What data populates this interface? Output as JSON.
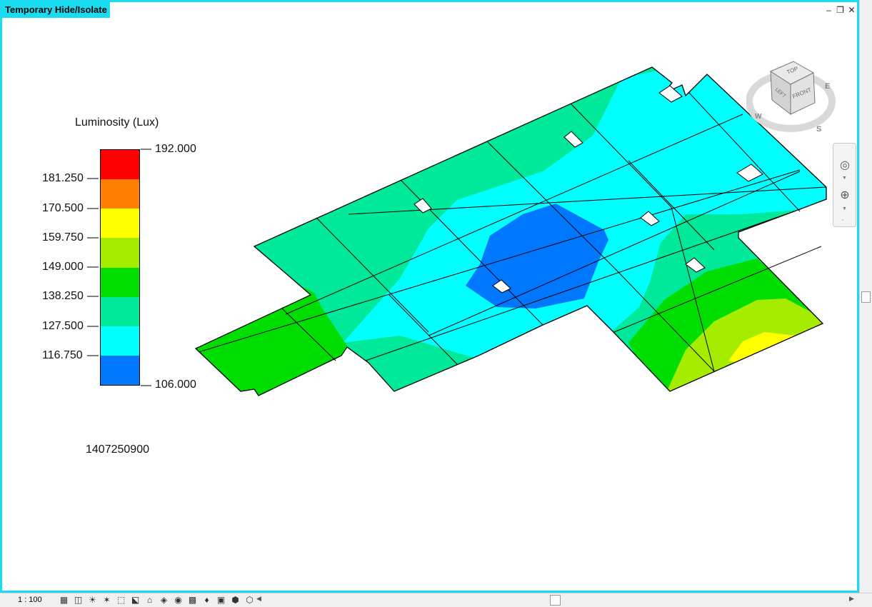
{
  "window": {
    "title": "Temporary Hide/Isolate",
    "controls": {
      "minimize": "‒",
      "restore": "❐",
      "close": "✕"
    }
  },
  "legend": {
    "title": "Luminosity (Lux)",
    "max_label": "192.000",
    "min_label": "106.000",
    "left_labels": [
      "181.250",
      "170.500",
      "159.750",
      "149.000",
      "138.250",
      "127.500",
      "116.750"
    ],
    "colors": [
      "#ff0000",
      "#ff7f00",
      "#ffff00",
      "#a5ec00",
      "#00dd00",
      "#00e89a",
      "#00ffff",
      "#0077ff"
    ]
  },
  "timestamp": "1407250900",
  "viewcube": {
    "top": "TOP",
    "left": "LEFT",
    "front": "FRONT",
    "east": "E",
    "south": "S",
    "west": "W"
  },
  "navigation_bar": {
    "wheel_icon": "steering-wheel-icon",
    "zoom_icon": "zoom-icon"
  },
  "status_bar": {
    "scale": "1 : 100",
    "tool_icons": [
      "detail-level-icon",
      "visual-style-icon",
      "sun-path-icon",
      "shadows-icon",
      "crop-view-icon",
      "show-crop-icon",
      "unlock-3d-icon",
      "temporary-hide-icon",
      "reveal-hidden-icon",
      "analysis-display-icon",
      "highlight-icon",
      "render-icon",
      "3d-view-icon",
      "worksharing-icon"
    ],
    "tool_glyphs": [
      "▦",
      "◫",
      "☀",
      "✶",
      "⬚",
      "⬕",
      "⌂",
      "◈",
      "◉",
      "▩",
      "♦",
      "▣",
      "⬢",
      "⬡"
    ]
  }
}
